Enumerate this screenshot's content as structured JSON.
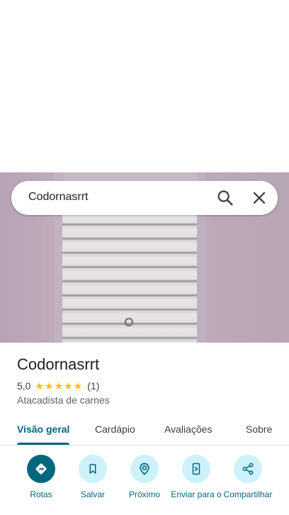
{
  "search": {
    "query": "Codornasrrt"
  },
  "place": {
    "name": "Codornasrrt",
    "rating": "5,0",
    "stars": 5,
    "review_count": "(1)",
    "category": "Atacadista de carnes"
  },
  "tabs": [
    {
      "label": "Visão geral",
      "active": true
    },
    {
      "label": "Cardápio",
      "active": false
    },
    {
      "label": "Avaliações",
      "active": false
    },
    {
      "label": "Sobre",
      "active": false
    }
  ],
  "actions": [
    {
      "label": "Rotas",
      "icon": "directions-icon"
    },
    {
      "label": "Salvar",
      "icon": "bookmark-icon"
    },
    {
      "label": "Próximo",
      "icon": "nearby-icon"
    },
    {
      "label": "Enviar para o",
      "icon": "send-to-phone-icon"
    },
    {
      "label": "Compartilhar",
      "icon": "share-icon"
    }
  ],
  "colors": {
    "accent": "#00677d",
    "action_bg": "#cdf2fb",
    "star": "#fbbc04"
  }
}
